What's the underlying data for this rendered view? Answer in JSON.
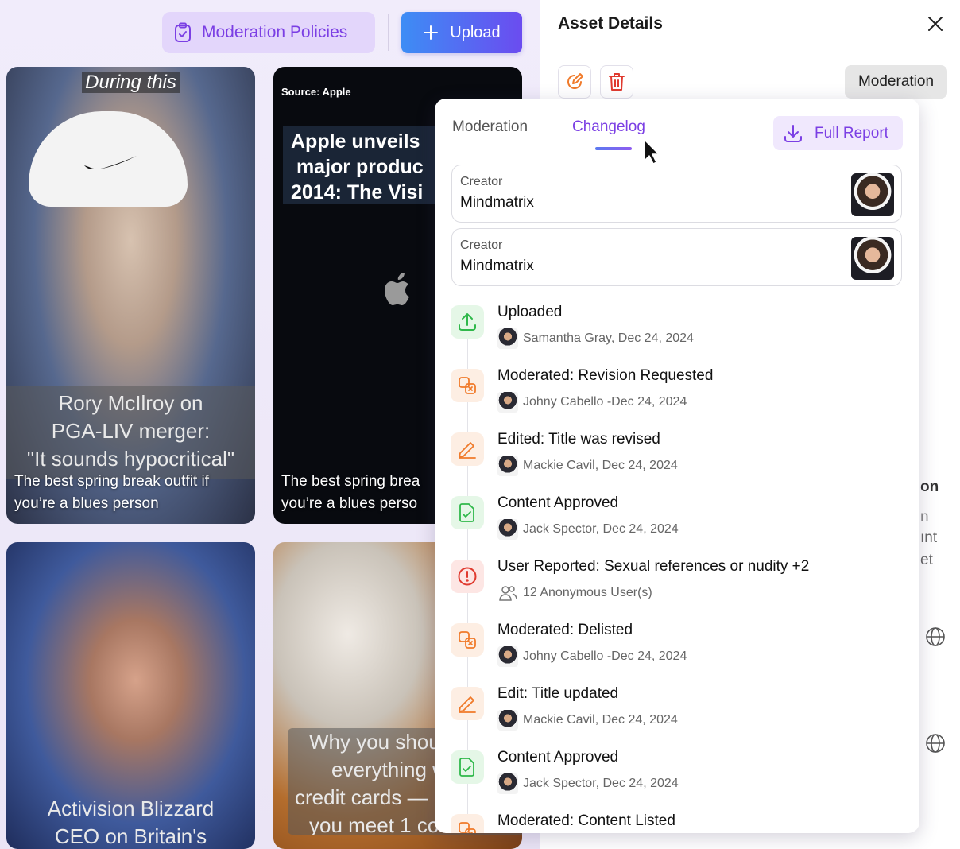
{
  "toolbar": {
    "policies_label": "Moderation Policies",
    "upload_label": "Upload"
  },
  "gallery": {
    "cards": [
      {
        "top_caption": "During this",
        "overlay_lines": [
          "Rory McIlroy on",
          "PGA-LIV merger:",
          "\"It sounds hypocritical\""
        ],
        "caption_lines": [
          "The best spring break outfit if",
          "you’re a blues person"
        ]
      },
      {
        "source": "Source: Apple",
        "headline_lines": [
          "Apple unveils",
          " major produc",
          "2014: The Visi"
        ],
        "caption_lines": [
          "The best spring brea",
          "you’re a blues perso"
        ]
      },
      {
        "overlay_lines": [
          "Activision Blizzard",
          "CEO on Britain's"
        ]
      },
      {
        "overlay_lines": [
          "Why you shoul",
          "everything w",
          "credit cards — p",
          "you meet 1 cor"
        ]
      }
    ]
  },
  "panel": {
    "title": "Asset Details",
    "moderation_label": "Moderation",
    "faint_texts": [
      "on",
      "n",
      "ınt",
      "et"
    ]
  },
  "popover": {
    "tabs": [
      {
        "label": "Moderation",
        "active": false
      },
      {
        "label": "Changelog",
        "active": true
      }
    ],
    "full_report_label": "Full Report",
    "creators": [
      {
        "label": "Creator",
        "name": "Mindmatrix"
      },
      {
        "label": "Creator",
        "name": "Mindmatrix"
      }
    ],
    "events": [
      {
        "type": "upload",
        "title": "Uploaded",
        "meta": "Samantha Gray, Dec 24, 2024"
      },
      {
        "type": "moderated",
        "title": "Moderated: Revision Requested",
        "meta": "Johny Cabello -Dec 24, 2024"
      },
      {
        "type": "edit",
        "title": "Edited: Title was revised",
        "meta": "Mackie Cavil, Dec 24, 2024"
      },
      {
        "type": "approved",
        "title": "Content Approved",
        "meta": "Jack Spector, Dec 24, 2024"
      },
      {
        "type": "reported",
        "title": "User Reported: Sexual references or nudity +2",
        "meta": "12 Anonymous User(s)"
      },
      {
        "type": "moderated",
        "title": "Moderated: Delisted",
        "meta": "Johny Cabello -Dec 24, 2024"
      },
      {
        "type": "edit",
        "title": "Edit: Title updated",
        "meta": "Mackie Cavil, Dec 24, 2024"
      },
      {
        "type": "approved",
        "title": "Content Approved",
        "meta": "Jack Spector, Dec 24, 2024"
      },
      {
        "type": "moderated",
        "title": "Moderated: Content Listed",
        "meta": ""
      }
    ]
  },
  "colors": {
    "accent": "#7b3fe4",
    "success": "#2fb84a",
    "warning": "#f07a2a",
    "danger": "#e03a2f"
  }
}
